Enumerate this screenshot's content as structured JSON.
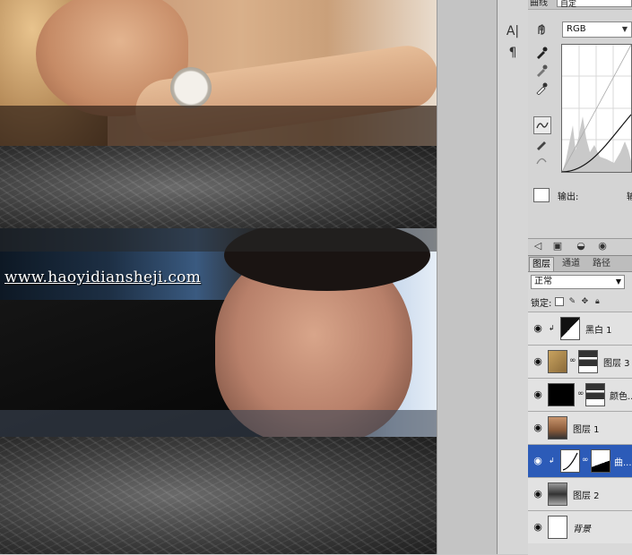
{
  "canvas": {
    "watermark": "www.haoyidiansheji.com"
  },
  "tools": {
    "hand_icon": "hand-icon",
    "text_icon": "A|",
    "paragraph_icon": "¶"
  },
  "curves": {
    "preset_label": "曲线",
    "preset_value": "自定",
    "channel": "RGB",
    "output_label": "输出:",
    "output_value": "输"
  },
  "layers": {
    "tabs": [
      "图层",
      "通道",
      "路径"
    ],
    "blend_mode": "正常",
    "lock_label": "锁定:",
    "items": [
      {
        "name": "黑白 1"
      },
      {
        "name": "图层 3"
      },
      {
        "name": "颜色..."
      },
      {
        "name": "图层 1"
      },
      {
        "name": "曲..."
      },
      {
        "name": "图层 2"
      },
      {
        "name": "背景"
      }
    ]
  },
  "colors": {
    "selection": "#2c5bb8",
    "panel": "#d9d9d9"
  }
}
